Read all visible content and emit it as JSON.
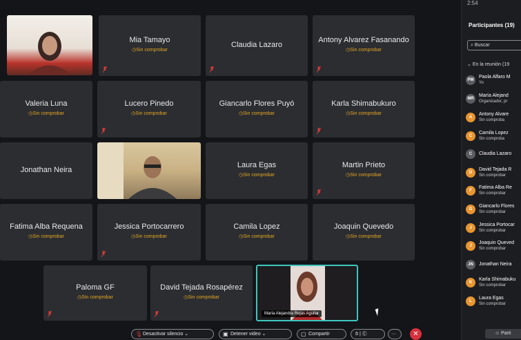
{
  "colors": {
    "accent_status": "#e6a822",
    "active_speaker": "#3ec7c0",
    "end_call": "#d8303c",
    "muted_mic": "#d23a3a"
  },
  "grid": {
    "status_label": "Sin comprobar",
    "tiles": [
      {
        "name": "Mia Tamayo",
        "verified": false
      },
      {
        "name": "Claudia Lazaro",
        "verified": true
      },
      {
        "name": "Antony Alvarez Fasanando",
        "verified": false
      },
      {
        "name": "Valeria Luna",
        "verified": false
      },
      {
        "name": "Lucero Pinedo",
        "verified": false
      },
      {
        "name": "Giancarlo Flores Puyó",
        "verified": false
      },
      {
        "name": "Karla Shimabukuro",
        "verified": false
      },
      {
        "name": "Jonathan Neira",
        "verified": true
      },
      {
        "name": "Laura Egas",
        "verified": false
      },
      {
        "name": "Martin Prieto",
        "verified": false
      },
      {
        "name": "Fatima Alba Requena",
        "verified": false
      },
      {
        "name": "Jessica Portocarrero",
        "verified": false
      },
      {
        "name": "Camila Lopez",
        "verified": false
      },
      {
        "name": "Joaquin Quevedo",
        "verified": false
      },
      {
        "name": "Paloma GF",
        "verified": false
      },
      {
        "name": "David Tejada Rosapérez",
        "verified": false
      }
    ],
    "self_view_caption": "María Alejandra Rojas Aguilar"
  },
  "controls": {
    "mute_label": "Desactivar silencio",
    "video_label": "Detener video",
    "share_label": "Compartir",
    "more_label": "···",
    "end_label": "✕"
  },
  "panel": {
    "topbar": "2:54",
    "title": "Participantes (19)",
    "search_placeholder": "Buscar",
    "section": "En la reunión (19",
    "people": [
      {
        "initials": "PM",
        "name": "Paola Alfaro M",
        "sub": "Yo",
        "color": "#5b5c62"
      },
      {
        "initials": "MR",
        "name": "María Alejand",
        "sub": "Organizador, pr",
        "color": "#5b5c62"
      },
      {
        "initials": "A",
        "name": "Antony Alvare",
        "sub": "Sin comproba",
        "color": "#e8952f"
      },
      {
        "initials": "C",
        "name": "Camila Lopez",
        "sub": "Sin comproba",
        "color": "#e8952f"
      },
      {
        "initials": "C",
        "name": "Claudia Lazaro",
        "sub": "",
        "color": "#5b5c62"
      },
      {
        "initials": "D",
        "name": "David Tejada R",
        "sub": "Sin comprobar",
        "color": "#e8952f"
      },
      {
        "initials": "F",
        "name": "Fatima Alba Re",
        "sub": "Sin comprobar",
        "color": "#e8952f"
      },
      {
        "initials": "G",
        "name": "Giancarlo Flores",
        "sub": "Sin comprobar",
        "color": "#e8952f"
      },
      {
        "initials": "J",
        "name": "Jessica Portocar",
        "sub": "Sin comprobar",
        "color": "#e8952f"
      },
      {
        "initials": "J",
        "name": "Joaquin Queved",
        "sub": "Sin comprobar",
        "color": "#e8952f"
      },
      {
        "initials": "JN",
        "name": "Jonathan Neira",
        "sub": "",
        "color": "#5b5c62"
      },
      {
        "initials": "K",
        "name": "Karla Shimabuku",
        "sub": "Sin comprobar",
        "color": "#e8952f"
      },
      {
        "initials": "L",
        "name": "Laura Egas",
        "sub": "Sin comprobar",
        "color": "#e8952f"
      }
    ],
    "bottom_button": "Parti"
  }
}
